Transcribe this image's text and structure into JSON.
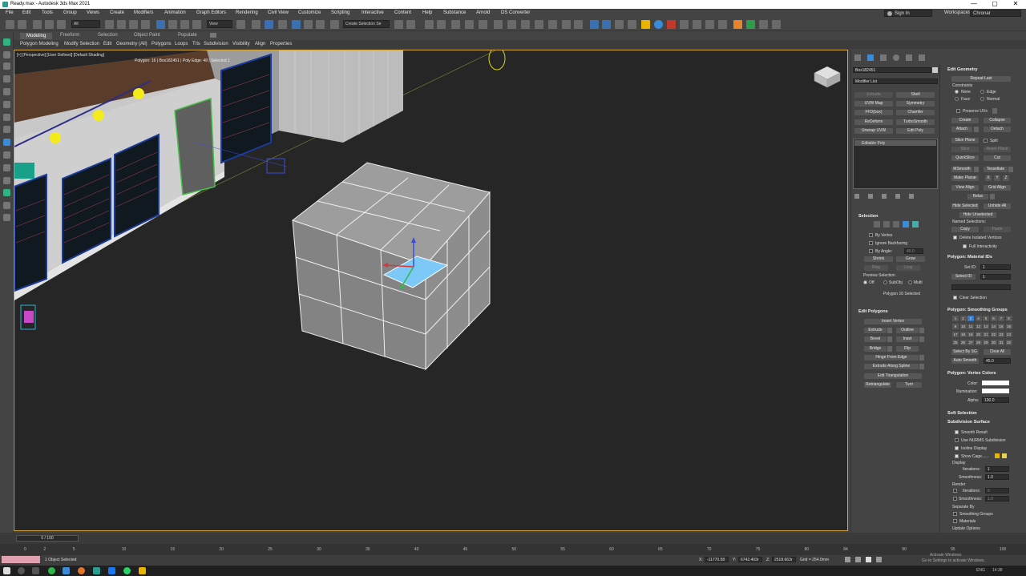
{
  "window": {
    "title": "Ready.max - Autodesk 3ds Max 2021",
    "buttons": [
      "—",
      "▢",
      "✕"
    ]
  },
  "menu": {
    "items": [
      "File",
      "Edit",
      "Tools",
      "Group",
      "Views",
      "Create",
      "Modifiers",
      "Animation",
      "Graph Editors",
      "Rendering",
      "Civil View",
      "Customize",
      "Scripting",
      "Interactive",
      "Content",
      "Help",
      "Substance",
      "Arnold",
      "DS Converter"
    ],
    "sign_in": "Sign In",
    "workspaces_label": "Workspaces:",
    "workspace": "Chronar"
  },
  "toolbar": {
    "filter": "All",
    "ref_coord": "View",
    "selection_set": "Create Selection Se"
  },
  "ribbon": {
    "tabs": [
      "Modeling",
      "Freeform",
      "Selection",
      "Object Paint",
      "Populate"
    ],
    "active_tab": "Modeling",
    "items": [
      "Polygon Modeling",
      "Modify Selection",
      "Edit",
      "Geometry (All)",
      "Polygons",
      "Loops",
      "Tris",
      "Subdivision",
      "Visibility",
      "Align",
      "Properties"
    ]
  },
  "viewport": {
    "label": "[+] [Perspective] [User Defined] [Default Shading]",
    "overlay": "Polygon: 16 | Box182451 | Poly Edge: 48 | Selected 1"
  },
  "command_panel": {
    "object_name": "Box182451",
    "modifier_list": "Modifier List",
    "modifier_buttons": [
      "Extrude",
      "Shell",
      "UVW Map",
      "Symmetry",
      "FFD(box)",
      "Chamfer",
      "ReDeform",
      "TurboSmooth",
      "Unwrap UVW",
      "Edit Poly"
    ],
    "stack_item": "Editable Poly",
    "selection": {
      "title": "Selection",
      "by_vertex": "By Vertex",
      "ignore_backfacing": "Ignore Backfacing",
      "by_angle": "By Angle:",
      "by_angle_value": "45.0",
      "shrink": "Shrink",
      "grow": "Grow",
      "ring": "Ring",
      "loop": "Loop",
      "preview_selection": "Preview Selection",
      "preview_options": [
        "Off",
        "SubObj",
        "Multi"
      ],
      "status": "Polygon 16 Selected"
    },
    "edit_polygons": {
      "title": "Edit Polygons",
      "insert_vertex": "Insert Vertex",
      "extrude": "Extrude",
      "outline": "Outline",
      "bevel": "Bevel",
      "inset": "Inset",
      "bridge": "Bridge",
      "flip": "Flip",
      "hinge_from_edge": "Hinge From Edge",
      "extrude_along_spline": "Extrude Along Spline",
      "edit_triangulation": "Edit Triangulation",
      "retriangulate": "Retriangulate",
      "turn": "Turn"
    }
  },
  "rollouts": {
    "edit_geometry": {
      "title": "Edit Geometry",
      "repeat_last": "Repeat Last",
      "constraints": "Constraints",
      "none": "None",
      "edge": "Edge",
      "face": "Face",
      "normal": "Normal",
      "preserve_uvs": "Preserve UVs",
      "create": "Create",
      "collapse": "Collapse",
      "attach": "Attach",
      "detach": "Detach",
      "slice_plane": "Slice Plane",
      "split": "Split",
      "slice": "Slice",
      "reset_plane": "Reset Plane",
      "quickslice": "QuickSlice",
      "cut": "Cut",
      "msmooth": "MSmooth",
      "tessellate": "Tessellate",
      "make_planar": "Make Planar",
      "x": "X",
      "y": "Y",
      "z": "Z",
      "view_align": "View Align",
      "grid_align": "Grid Align",
      "relax": "Relax",
      "hide_selected": "Hide Selected",
      "unhide_all": "Unhide All",
      "hide_unselected": "Hide Unselected",
      "named_selections": "Named Selections:",
      "copy": "Copy",
      "paste": "Paste",
      "delete_isolated": "Delete Isolated Vertices",
      "full_interactivity": "Full Interactivity"
    },
    "material_ids": {
      "title": "Polygon: Material IDs",
      "set_id": "Set ID:",
      "set_id_value": "1",
      "select_id": "Select ID",
      "select_id_value": "1",
      "clear_selection": "Clear Selection"
    },
    "smoothing_groups": {
      "title": "Polygon: Smoothing Groups",
      "numbers": [
        "1",
        "2",
        "3",
        "4",
        "5",
        "6",
        "7",
        "8",
        "9",
        "10",
        "11",
        "12",
        "13",
        "14",
        "15",
        "16",
        "17",
        "18",
        "19",
        "20",
        "21",
        "22",
        "23",
        "24",
        "25",
        "26",
        "27",
        "28",
        "29",
        "30",
        "31",
        "32"
      ],
      "active": "3",
      "select_by_sg": "Select By SG",
      "clear_all": "Clear All",
      "auto_smooth": "Auto Smooth",
      "auto_smooth_value": "45.0"
    },
    "vertex_colors": {
      "title": "Polygon: Vertex Colors",
      "color": "Color:",
      "illumination": "Illumination:",
      "alpha": "Alpha:",
      "alpha_value": "100.0"
    },
    "soft_selection": {
      "title": "Soft Selection"
    },
    "subdivision_surface": {
      "title": "Subdivision Surface",
      "smooth_result": "Smooth Result",
      "use_nurms": "Use NURMS Subdivision",
      "isoline_display": "Isoline Display",
      "show_cage": "Show Cage......",
      "display": "Display",
      "iterations": "Iterations:",
      "iterations_value": "1",
      "smoothness": "Smoothness:",
      "smoothness_value": "1.0",
      "render": "Render",
      "r_iterations_value": "0",
      "r_smoothness_value": "1.0",
      "separate_by": "Separate By",
      "smoothing_groups": "Smoothing Groups",
      "materials": "Materials",
      "update_options": "Update Options"
    }
  },
  "timeline": {
    "frame": "0 / 100",
    "ticks": [
      "0",
      "2",
      "5",
      "10",
      "15",
      "20",
      "25",
      "30",
      "35",
      "40",
      "45",
      "50",
      "55",
      "60",
      "65",
      "70",
      "75",
      "80",
      "84",
      "90",
      "95",
      "100"
    ]
  },
  "status": {
    "selected": "1 Object Selected",
    "x_label": "X:",
    "x_value": "-11770.58",
    "y_label": "Y:",
    "y_value": "6742.403r",
    "z_label": "Z:",
    "z_value": "2518.663r",
    "grid": "Grid = 254.0mm",
    "watermark_line1": "Activate Windows",
    "watermark_line2": "Go to Settings to activate Windows."
  },
  "taskbar": {
    "lang": "ENG",
    "time": "14:38"
  }
}
